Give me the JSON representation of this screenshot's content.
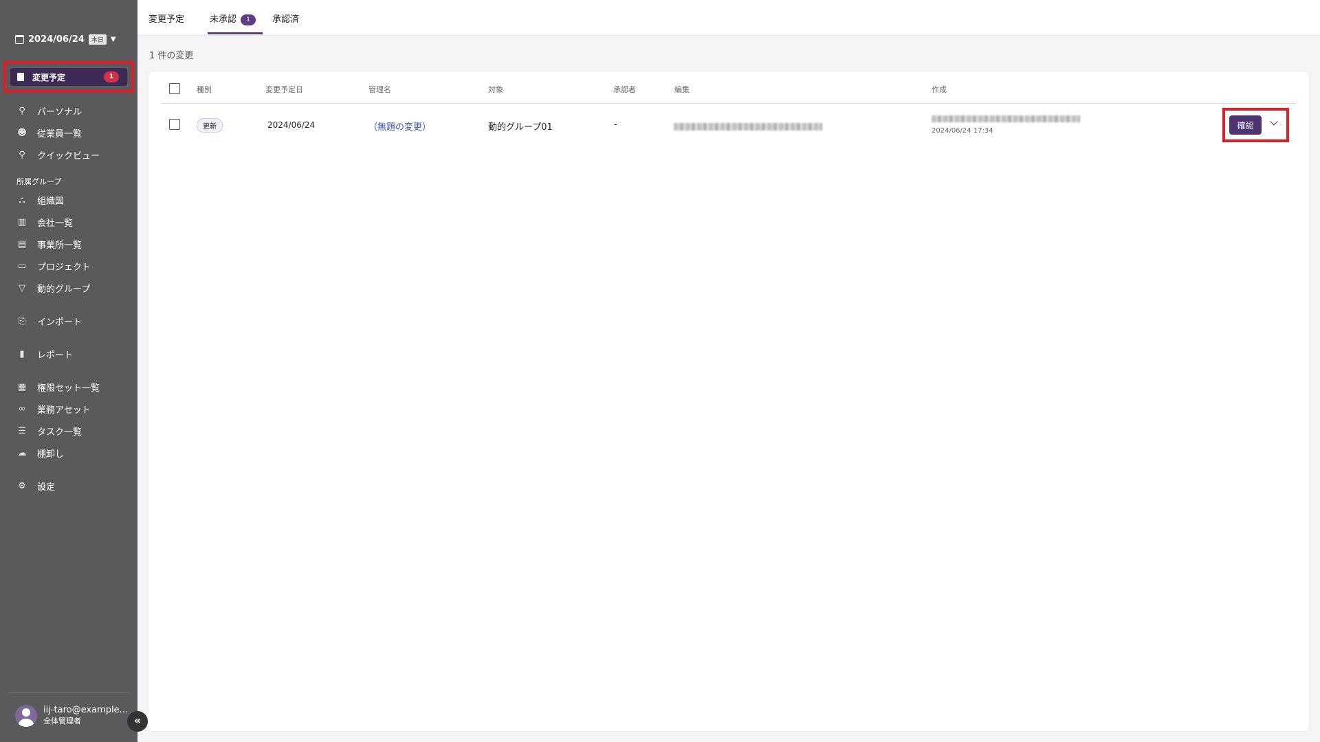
{
  "sidebar": {
    "date": "2024/06/24",
    "today_label": "本日",
    "active_item": {
      "label": "変更予定",
      "count": "1"
    },
    "items": [
      {
        "label": "パーソナル",
        "icon": "person-icon"
      },
      {
        "label": "従業員一覧",
        "icon": "people-icon"
      },
      {
        "label": "クイックビュー",
        "icon": "search-icon"
      }
    ],
    "section_label": "所属グループ",
    "group_items": [
      {
        "label": "組織図",
        "icon": "org-chart-icon"
      },
      {
        "label": "会社一覧",
        "icon": "building-icon"
      },
      {
        "label": "事業所一覧",
        "icon": "office-icon"
      },
      {
        "label": "プロジェクト",
        "icon": "briefcase-icon"
      },
      {
        "label": "動的グループ",
        "icon": "filter-icon"
      }
    ],
    "import_label": "インポート",
    "report_label": "レポート",
    "tool_items": [
      {
        "label": "権限セット一覧",
        "icon": "grid-icon"
      },
      {
        "label": "業務アセット",
        "icon": "link-icon"
      },
      {
        "label": "タスク一覧",
        "icon": "list-icon"
      },
      {
        "label": "棚卸し",
        "icon": "cloud-icon"
      }
    ],
    "settings_label": "設定",
    "user": {
      "email": "iij-taro@example...",
      "role": "全体管理者"
    },
    "collapse_glyph": "«"
  },
  "tabs": {
    "scheduled": "変更予定",
    "unapproved": "未承認",
    "unapproved_count": "1",
    "approved": "承認済"
  },
  "count_label": "1 件の変更",
  "table": {
    "headers": {
      "type": "種別",
      "scheduled_date": "変更予定日",
      "management_name": "管理名",
      "target": "対象",
      "approver": "承認者",
      "editor": "編集",
      "creator": "作成"
    },
    "rows": [
      {
        "type": "更新",
        "scheduled_date": "2024/06/24",
        "management_name": "（無題の変更）",
        "target": "動的グループ01",
        "approver": "-",
        "created_time": "2024/06/24 17:34",
        "confirm_label": "確認"
      }
    ]
  },
  "colors": {
    "sidebar_bg": "#5a5a5c",
    "accent": "#5b3f85",
    "highlight": "#e11d2a"
  }
}
